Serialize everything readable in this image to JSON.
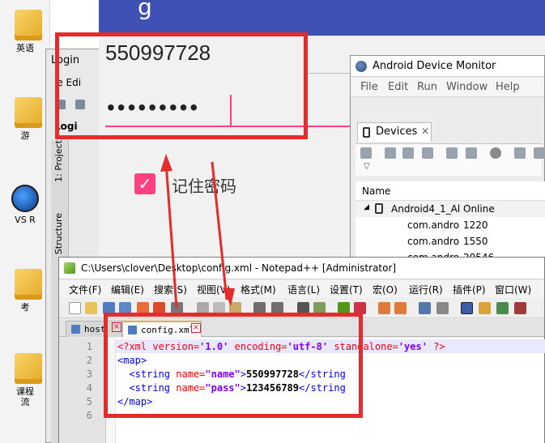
{
  "desktop": {
    "icons": [
      {
        "label": "英语",
        "kind": "folder"
      },
      {
        "label": "游",
        "kind": "folder"
      },
      {
        "label": "VS R",
        "kind": "app"
      },
      {
        "label": "考",
        "kind": "folder"
      },
      {
        "label": "课程",
        "kind": "folder"
      },
      {
        "label": "流",
        "kind": "folder"
      }
    ]
  },
  "android_studio": {
    "title": "Login",
    "menu": "le  Edi",
    "tab": "Logi",
    "side_tabs": [
      "1: Project",
      "Structure"
    ]
  },
  "emulator": {
    "username": "550997728",
    "password_mask": "•••••••••",
    "remember_label": "记住密码",
    "checkbox_checked": true,
    "accent_color": "#ff4081",
    "appbar_color": "#3f51b5"
  },
  "device_monitor": {
    "title": "Android Device Monitor",
    "menu": [
      "File",
      "Edit",
      "Run",
      "Window",
      "Help"
    ],
    "devices_tab": "Devices",
    "table_header": "Name",
    "rows": [
      {
        "name": "Android4_1_Al",
        "status": "Online"
      },
      {
        "name": "com.andro",
        "pid": "1220"
      },
      {
        "name": "com.andro",
        "pid": "1550"
      },
      {
        "name": "com.andro",
        "pid": "20546"
      }
    ]
  },
  "notepad": {
    "title": "C:\\Users\\clover\\Desktop\\config.xml - Notepad++ [Administrator]",
    "menu": [
      "文件(F)",
      "编辑(E)",
      "搜索(S)",
      "视图(V)",
      "格式(M)",
      "语言(L)",
      "设置(T)",
      "宏(O)",
      "运行(R)",
      "插件(P)",
      "窗口(W)"
    ],
    "tabs": [
      {
        "label": "host"
      },
      {
        "label": "config.xml",
        "active": true
      }
    ],
    "line_numbers": [
      "1",
      "2",
      "3",
      "4",
      "5",
      "6"
    ],
    "code": {
      "l1": {
        "pi_open": "<?xml",
        "a1": " version=",
        "v1": "'1.0'",
        "a2": " encoding=",
        "v2": "'utf-8'",
        "a3": " standalone=",
        "v3": "'yes'",
        "pi_close": " ?>"
      },
      "l2": {
        "tag": "<map>"
      },
      "l3": {
        "open": "<string",
        "attr": " name=",
        "val": "\"name\"",
        "close": ">",
        "text": "550997728",
        "end": "</string"
      },
      "l4": {
        "open": "<string",
        "attr": " name=",
        "val": "\"pass\"",
        "close": ">",
        "text": "123456789",
        "end": "</string"
      },
      "l5": {
        "tag": "</map>"
      }
    }
  },
  "highlight_color": "#e52b2b"
}
